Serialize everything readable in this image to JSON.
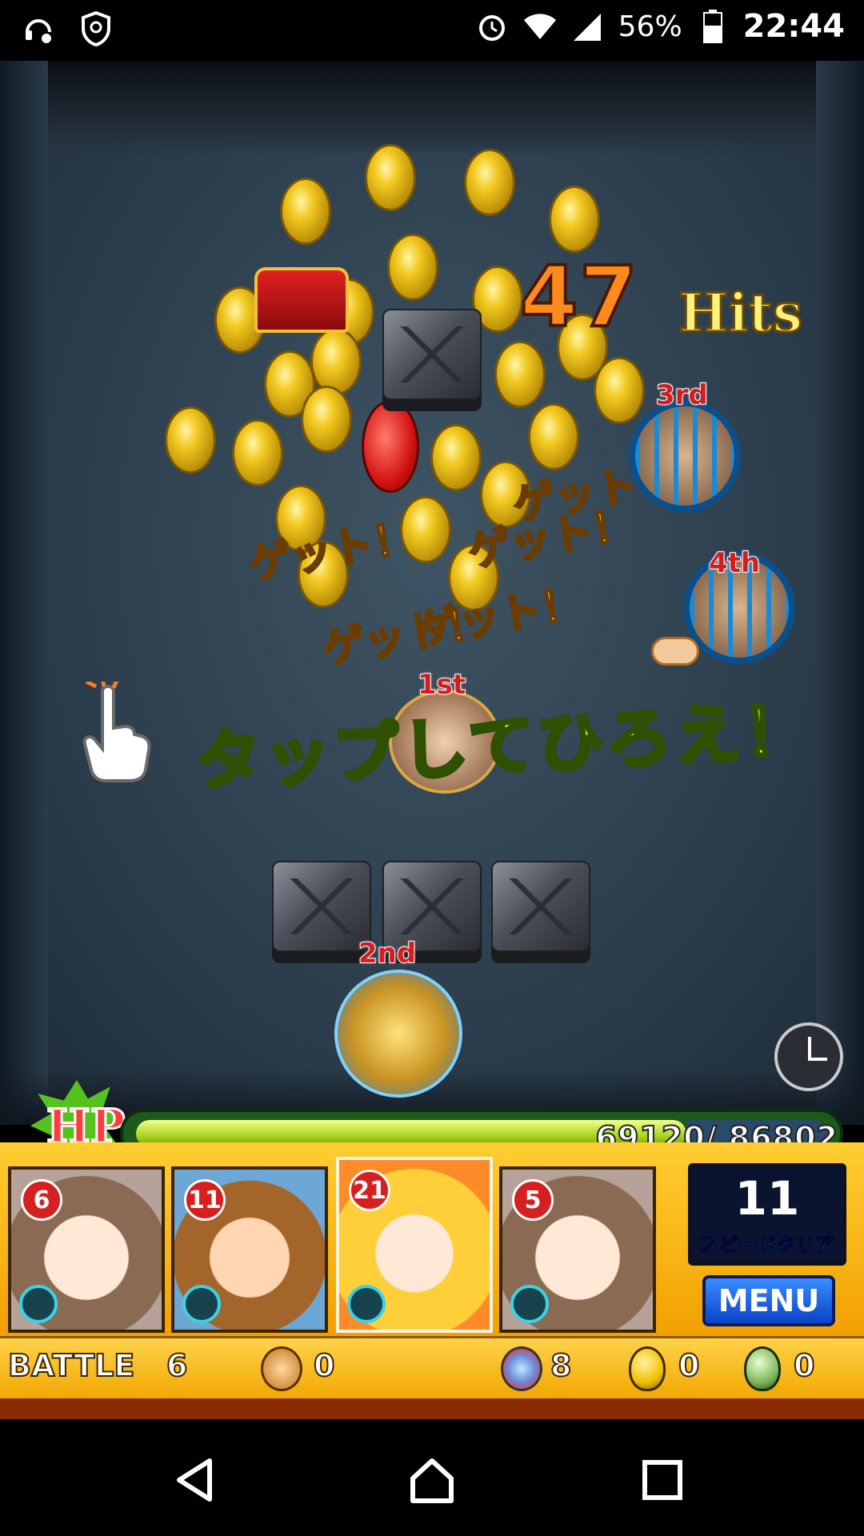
{
  "status_bar": {
    "battery": "56%",
    "time": "22:44",
    "icons": [
      "headset-settings-icon",
      "shield-icon",
      "alarm-icon",
      "wifi-icon",
      "signal-icon",
      "battery-icon"
    ]
  },
  "battle": {
    "combo_number": "47",
    "combo_word": "Hits",
    "get_popups": [
      "ゲット！",
      "ゲット！",
      "ゲット！",
      "ゲット！",
      "ゲット！"
    ],
    "instruction": "タップしてひろえ！",
    "ranks": [
      "1st",
      "2nd",
      "3rd",
      "4th"
    ]
  },
  "hud": {
    "hp_label": "HP",
    "hp_current": 69120,
    "hp_max": 86802,
    "hp_text": "69120/ 86802",
    "team": [
      {
        "level": "6",
        "color": "#c9a88a"
      },
      {
        "level": "11",
        "color": "#e8a057"
      },
      {
        "level": "21",
        "color": "#ffd84d"
      },
      {
        "level": "5",
        "color": "#c9a88a"
      }
    ],
    "speed_clear_turns": "11",
    "speed_clear_label": "スピードクリア",
    "menu_label": "MENU"
  },
  "info_bar": {
    "battle_label": "BATTLE",
    "battle_number": "6",
    "coins": "0",
    "orbs": "8",
    "gold_eggs": "0",
    "green_eggs": "0"
  },
  "colors": {
    "hp_fill": "#a8d31e",
    "panel": "#f2a000",
    "menu_button": "#0a43c7",
    "combo": "#ff8a1c"
  }
}
